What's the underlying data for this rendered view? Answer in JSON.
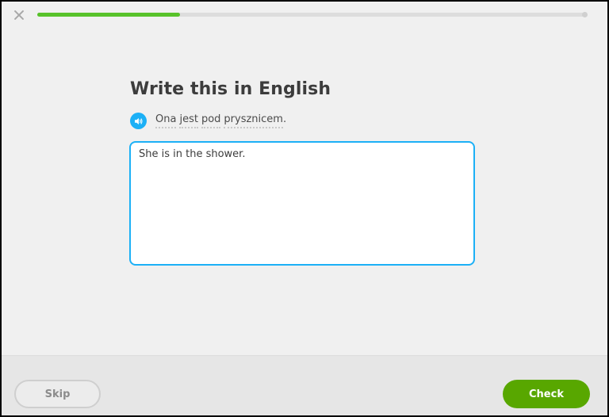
{
  "lesson": {
    "progress_percent": 26
  },
  "challenge": {
    "title": "Write this in English",
    "prompt_words": [
      "Ona",
      "jest",
      "pod",
      "prysznicem"
    ],
    "prompt_punctuation": "."
  },
  "answer": {
    "value": "She is in the shower."
  },
  "footer": {
    "skip_label": "Skip",
    "check_label": "Check"
  },
  "icons": {
    "close": "close-icon",
    "speaker": "speaker-icon"
  },
  "colors": {
    "progress": "#58c22a",
    "accent_blue": "#1cb0f6",
    "check_green": "#58a700"
  }
}
